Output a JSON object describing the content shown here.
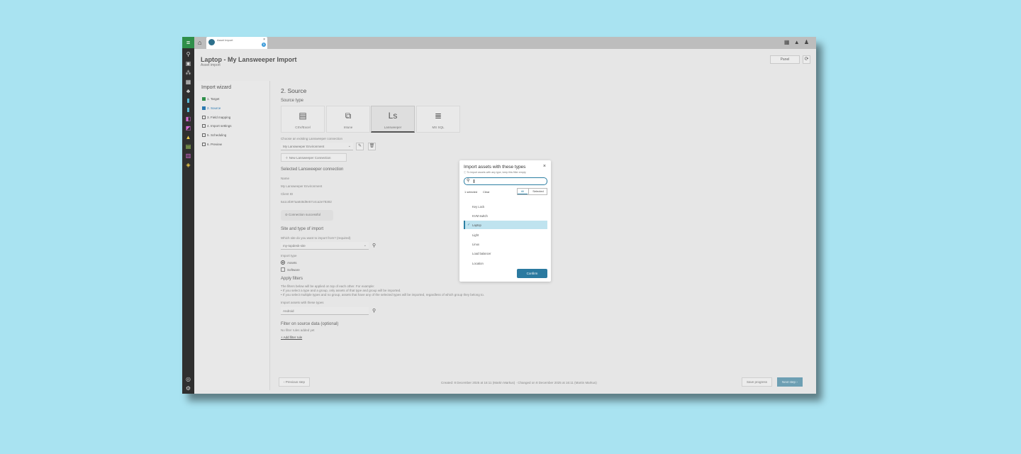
{
  "nav": {
    "menu_icon": "≡",
    "rail_icons": [
      "search-icon",
      "clipboard-icon",
      "network-icon",
      "apps-icon",
      "relations-icon",
      "report-icon",
      "report-icon",
      "security-icon",
      "dashboard-icon",
      "warning-icon",
      "inventory-icon",
      "chart-icon",
      "tag-icon"
    ],
    "bottom_icons": [
      "help-icon",
      "settings-icon"
    ]
  },
  "topbar": {
    "tab_label": "Asset Import",
    "tab_close": "×",
    "tab_badge": "5",
    "right_icons": "▦ ▲ ♟"
  },
  "header": {
    "title": "Laptop - My Lansweeper Import",
    "subtitle": "Asset import",
    "back_label": "Panel",
    "refresh_glyph": "⟳"
  },
  "wizard": {
    "title": "Import wizard",
    "steps": [
      {
        "label": "1. Target",
        "state": "done"
      },
      {
        "label": "2. Source",
        "state": "active"
      },
      {
        "label": "3. Field mapping",
        "state": "todo"
      },
      {
        "label": "4. Import settings",
        "state": "todo"
      },
      {
        "label": "5. Scheduling",
        "state": "todo"
      },
      {
        "label": "6. Preview",
        "state": "todo"
      }
    ]
  },
  "source": {
    "section_title": "2. Source",
    "source_type_label": "Source type",
    "types": [
      {
        "label": "CSV/Excel",
        "glyph": "▤"
      },
      {
        "label": "Intune",
        "glyph": "⧉"
      },
      {
        "label": "Lansweeper",
        "glyph": "Ls"
      },
      {
        "label": "MS SQL",
        "glyph": "≣"
      }
    ],
    "connection_label": "Choose an existing Lansweeper connection",
    "connection_value": "My Lansweeper Environment",
    "edit_glyph": "✎",
    "delete_glyph": "🗑",
    "new_connection": "New Lansweeper Connection",
    "selected_label": "Selected Lansweeper connection",
    "name_label": "Name",
    "name_value": "My Lansweeper Environment",
    "client_id_label": "Client ID",
    "client_id_value": "6a1c4b97aa848d9e57c4ca2e78382",
    "connection_ok": "Connection successful"
  },
  "site": {
    "title": "Site and type of import",
    "question": "Which site do you want to import from?",
    "required": "(required)",
    "site_value": "my-topdesk-site",
    "import_type_label": "Import type",
    "assets_label": "Assets",
    "software_label": "Software"
  },
  "filters": {
    "title": "Apply filters",
    "desc1": "The filters below will be applied on top of each other. For example:",
    "desc2": "• If you select a type and a group, only assets of that type and group will be imported.",
    "desc3": "• If you select multiple types and no group, assets that have any of the selected types will be imported, regardless of which group they belong to.",
    "types_label": "Import assets with these types",
    "types_value": "Android"
  },
  "source_filter": {
    "title": "Filter on source data (optional)",
    "sub": "No filter rules added yet",
    "add_rule": "Add filter rule"
  },
  "footer": {
    "previous": "Previous step",
    "info": "Created: 8 December 2025 at 16:11 (Martin Markus) · Changed on 8 December 2025 at 16:11 (Martin Markus)",
    "save": "Save progress",
    "next": "Next step"
  },
  "modal": {
    "title": "Import assets with these types",
    "close": "×",
    "info": "ⓘ To import assets with any type, keep this filter empty",
    "search_glyph": "⚲",
    "count": "1 selected",
    "clear": "Clear",
    "tab_all": "All",
    "tab_selected": "Selected",
    "items": [
      {
        "label": "Key Lock",
        "selected": false
      },
      {
        "label": "KVM switch",
        "selected": false
      },
      {
        "label": "Laptop",
        "selected": true
      },
      {
        "label": "Light",
        "selected": false
      },
      {
        "label": "Linux",
        "selected": false
      },
      {
        "label": "Load balancer",
        "selected": false
      },
      {
        "label": "Location",
        "selected": false
      }
    ],
    "check_glyph": "✓",
    "confirm": "Confirm"
  }
}
